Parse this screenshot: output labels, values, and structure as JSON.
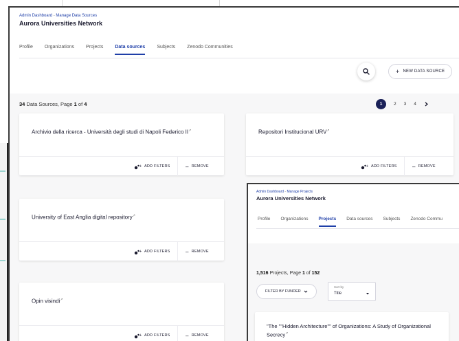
{
  "win1": {
    "breadcrumb": {
      "parent": "Admin Dashboard",
      "separator": "-",
      "current": "Manage Data Sources"
    },
    "title": "Aurora Universities Network",
    "tabs": [
      {
        "label": "Profile",
        "active": false
      },
      {
        "label": "Organizations",
        "active": false
      },
      {
        "label": "Projects",
        "active": false
      },
      {
        "label": "Data sources",
        "active": true
      },
      {
        "label": "Subjects",
        "active": false
      },
      {
        "label": "Zenodo Communities",
        "active": false
      }
    ],
    "search_icon": "search-icon",
    "new_button": {
      "icon": "plus-icon",
      "label": "NEW DATA SOURCE"
    },
    "summary": {
      "count": "34",
      "text_mid": " Data Sources, Page ",
      "page": "1",
      "of": " of ",
      "total_pages": "4"
    },
    "pagination": {
      "current": "1",
      "pages": [
        "2",
        "3",
        "4"
      ],
      "next_icon": "chevron-right-icon"
    },
    "cards": [
      {
        "name": "Archivio della ricerca - Università degli studi di Napoli Federico II",
        "add_label": "ADD FILTERS",
        "remove_label": "REMOVE"
      },
      {
        "name": "Repositori Institucional URV",
        "add_label": "ADD FILTERS",
        "remove_label": "REMOVE"
      },
      {
        "name": "University of East Anglia digital repository",
        "add_label": "ADD FILTERS",
        "remove_label": "REMOVE"
      },
      {
        "name": "Opin visindi",
        "add_label": "ADD FILTERS",
        "remove_label": "REMOVE"
      }
    ]
  },
  "win2": {
    "breadcrumb": {
      "parent": "Admin Dashboard",
      "separator": "-",
      "current": "Manage Projects"
    },
    "title": "Aurora Universities Network",
    "tabs": [
      {
        "label": "Profile",
        "active": false
      },
      {
        "label": "Organizations",
        "active": false
      },
      {
        "label": "Projects",
        "active": true
      },
      {
        "label": "Data sources",
        "active": false
      },
      {
        "label": "Subjects",
        "active": false
      },
      {
        "label": "Zenodo Commu",
        "active": false
      }
    ],
    "summary": {
      "count": "1,516",
      "text_mid": " Projects, Page ",
      "page": "1",
      "of": " of ",
      "total_pages": "152"
    },
    "filter_button": "FILTER BY FUNDER",
    "sort": {
      "label": "Sort by",
      "value": "Title"
    },
    "project_card": {
      "title": "\"The \"\"Hidden Architecture\"\" of Organizations: A Study of Organizational Secrecy"
    }
  },
  "colors": {
    "accent": "#1f3fa8",
    "page_active": "#1b2158",
    "background": "#f7f7f8"
  }
}
